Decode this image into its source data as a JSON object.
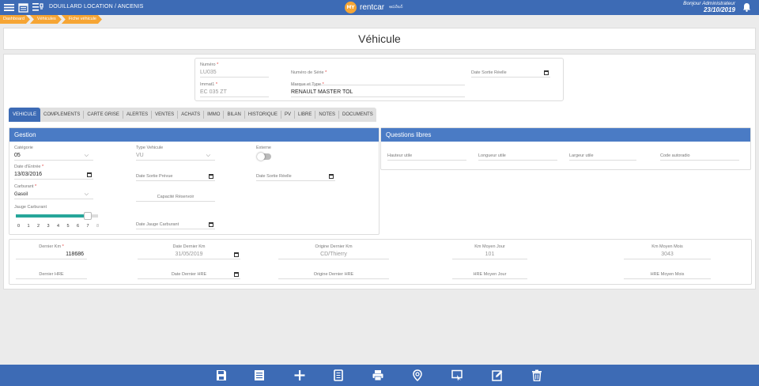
{
  "header": {
    "company": "DOUILLARD LOCATION / ANCENIS",
    "brand_logo": "MY",
    "brand_name": "rentcar",
    "brand_sub": "ఆపరేటర్",
    "greeting": "Bonjour Administrateur",
    "date": "23/10/2019",
    "icons": [
      "menu-icon",
      "calendar-grid-icon",
      "planning-icon",
      "bell-icon"
    ]
  },
  "breadcrumbs": [
    "Dashboard",
    "Véhicules",
    "Fiche véhicule"
  ],
  "page_title": "Véhicule",
  "top": {
    "numero_label": "Numéro",
    "numero_value": "LU035",
    "serie_label": "Numéro de Série",
    "serie_value": "",
    "date_sortie_label": "Date Sortie Réelle",
    "immat_label": "Immat1",
    "immat_value": "EC 035 ZT",
    "marque_label": "Marque et Type",
    "marque_value": "RENAULT MASTER TOL"
  },
  "tabs": [
    "VEHICULE",
    "COMPLEMENTS",
    "CARTE GRISE",
    "ALERTES",
    "VENTES",
    "ACHATS",
    "IMMO",
    "BILAN",
    "HISTORIQUE",
    "PV",
    "LIBRE",
    "NOTES",
    "DOCUMENTS"
  ],
  "gestion": {
    "title": "Gestion",
    "categorie_label": "Catégorie",
    "categorie_value": "05",
    "type_label": "Type Vehicule",
    "type_value": "VU",
    "externe_label": "Externe",
    "date_entree_label": "Date d'Entrée",
    "date_entree_value": "13/03/2016",
    "date_sortie_prevue_label": "Date Sortie Prévue",
    "date_sortie_reelle_label": "Date Sortie Réelle",
    "carburant_label": "Carburant",
    "carburant_value": "Gasoil",
    "capacite_label": "Capacité Réservoir",
    "jauge_label": "Jauge Carburant",
    "jauge_level": 7,
    "jauge_max": 8,
    "jauge_ticks": [
      "0",
      "1",
      "2",
      "3",
      "4",
      "5",
      "6",
      "7",
      "8"
    ],
    "date_jauge_label": "Date Jauge Carburant"
  },
  "questions": {
    "title": "Questions libres",
    "fields": [
      "Hauteur utile",
      "Longueur utile",
      "Largeur utile",
      "Code autoradio"
    ]
  },
  "km": {
    "dernier_km_label": "Dernier Km",
    "dernier_km_value": "118686",
    "date_dernier_km_label": "Date Dernier Km",
    "date_dernier_km_value": "31/05/2019",
    "origine_km_label": "Origine Dernier Km",
    "origine_km_value": "CD/Thierry",
    "km_moyen_jour_label": "Km Moyen Jour",
    "km_moyen_jour_value": "101",
    "km_moyen_mois_label": "Km Moyen Mois",
    "km_moyen_mois_value": "3043",
    "dernier_hre_label": "Dernier HRE",
    "date_dernier_hre_label": "Date Dernier HRE",
    "origine_hre_label": "Origine Dernier HRE",
    "hre_jour_label": "HRE Moyen Jour",
    "hre_mois_label": "HRE Moyen Mois"
  },
  "toolbar": [
    "save-icon",
    "list-icon",
    "add-icon",
    "copy-icon",
    "print-icon",
    "location-icon",
    "assign-icon",
    "edit-icon",
    "delete-icon"
  ],
  "colors": {
    "primary": "#3d6bb5",
    "accent": "#f6a534",
    "required": "#e53935",
    "slider": "#26a69a"
  }
}
